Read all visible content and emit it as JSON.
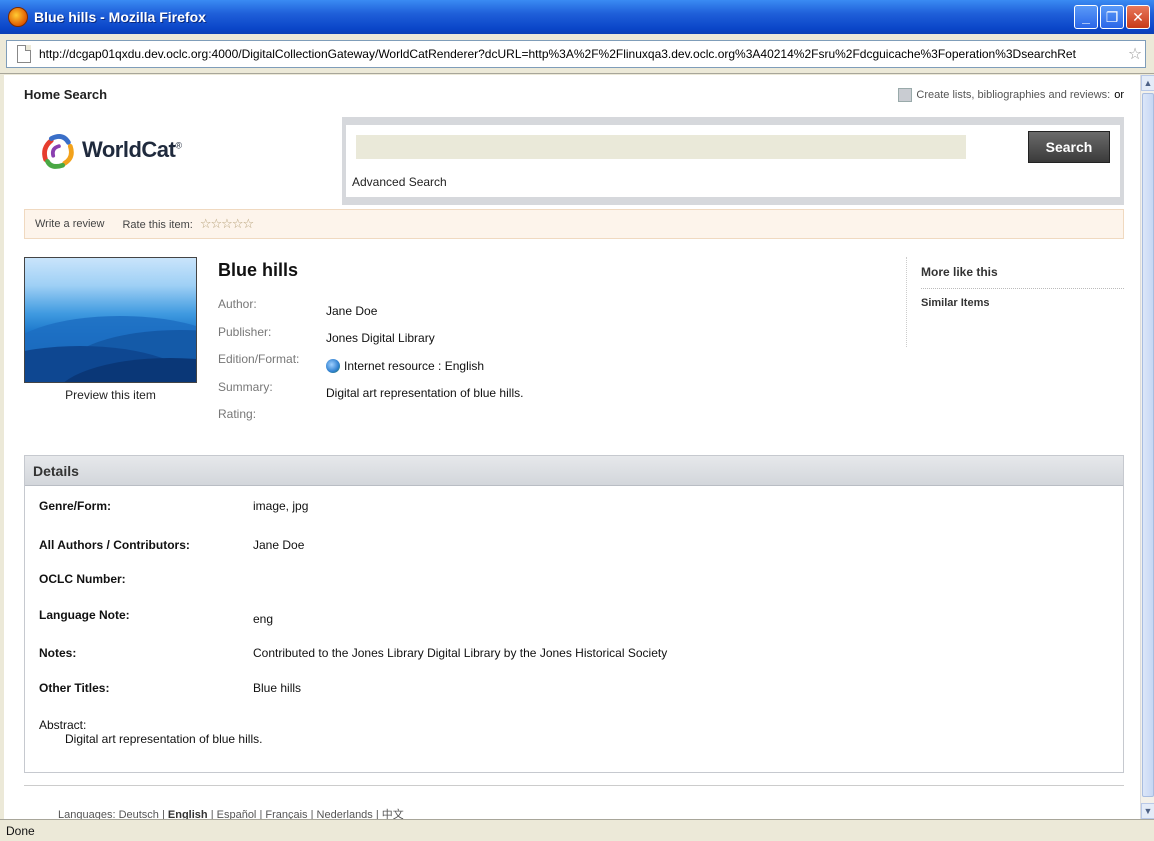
{
  "window": {
    "title": "Blue hills - Mozilla Firefox",
    "url": "http://dcgap01qxdu.dev.oclc.org:4000/DigitalCollectionGateway/WorldCatRenderer?dcURL=http%3A%2F%2Flinuxqa3.dev.oclc.org%3A40214%2Fsru%2Fdcguicache%3Foperation%3DsearchRet",
    "status": "Done"
  },
  "topnav": {
    "home_search": "Home Search",
    "create_lists": "Create lists, bibliographies and reviews:",
    "or": "or"
  },
  "banner": {
    "logo": "WorldCat",
    "logo_reg": "®",
    "search_button": "Search",
    "search_value": "",
    "advanced_search": "Advanced Search"
  },
  "reviewbar": {
    "write_review": "Write a review",
    "rate_label": "Rate this item:",
    "stars": "☆☆☆☆☆"
  },
  "item": {
    "title": "Blue hills",
    "preview": "Preview this item",
    "author_label": "Author:",
    "author": "Jane Doe",
    "publisher_label": "Publisher:",
    "publisher": "Jones Digital Library",
    "edition_label": "Edition/Format:",
    "edition": "Internet resource : English",
    "summary_label": "Summary:",
    "summary": "Digital art representation of blue hills.",
    "rating_label": "Rating:"
  },
  "morelike": {
    "title": "More like this",
    "similar": "Similar Items"
  },
  "details": {
    "header": "Details",
    "rows": [
      {
        "label": "Genre/Form:",
        "value": "image, jpg"
      },
      {
        "label": "All Authors / Contributors:",
        "value": "Jane Doe"
      },
      {
        "label": "OCLC Number:",
        "value": ""
      },
      {
        "label": "Language Note:",
        "value": "eng"
      },
      {
        "label": "Notes:",
        "value": "Contributed to the Jones Library Digital Library by the Jones Historical Society"
      },
      {
        "label": "Other Titles:",
        "value": "Blue hills"
      }
    ],
    "abstract_label": "Abstract:",
    "abstract": "Digital art representation of blue hills."
  },
  "footer": {
    "languages_label": "Languages:",
    "deutsch": "Deutsch",
    "english": "English",
    "espanol": "Español",
    "francais": "Français",
    "nederlands": "Nederlands",
    "chinese": "中文",
    "sep": "|"
  }
}
